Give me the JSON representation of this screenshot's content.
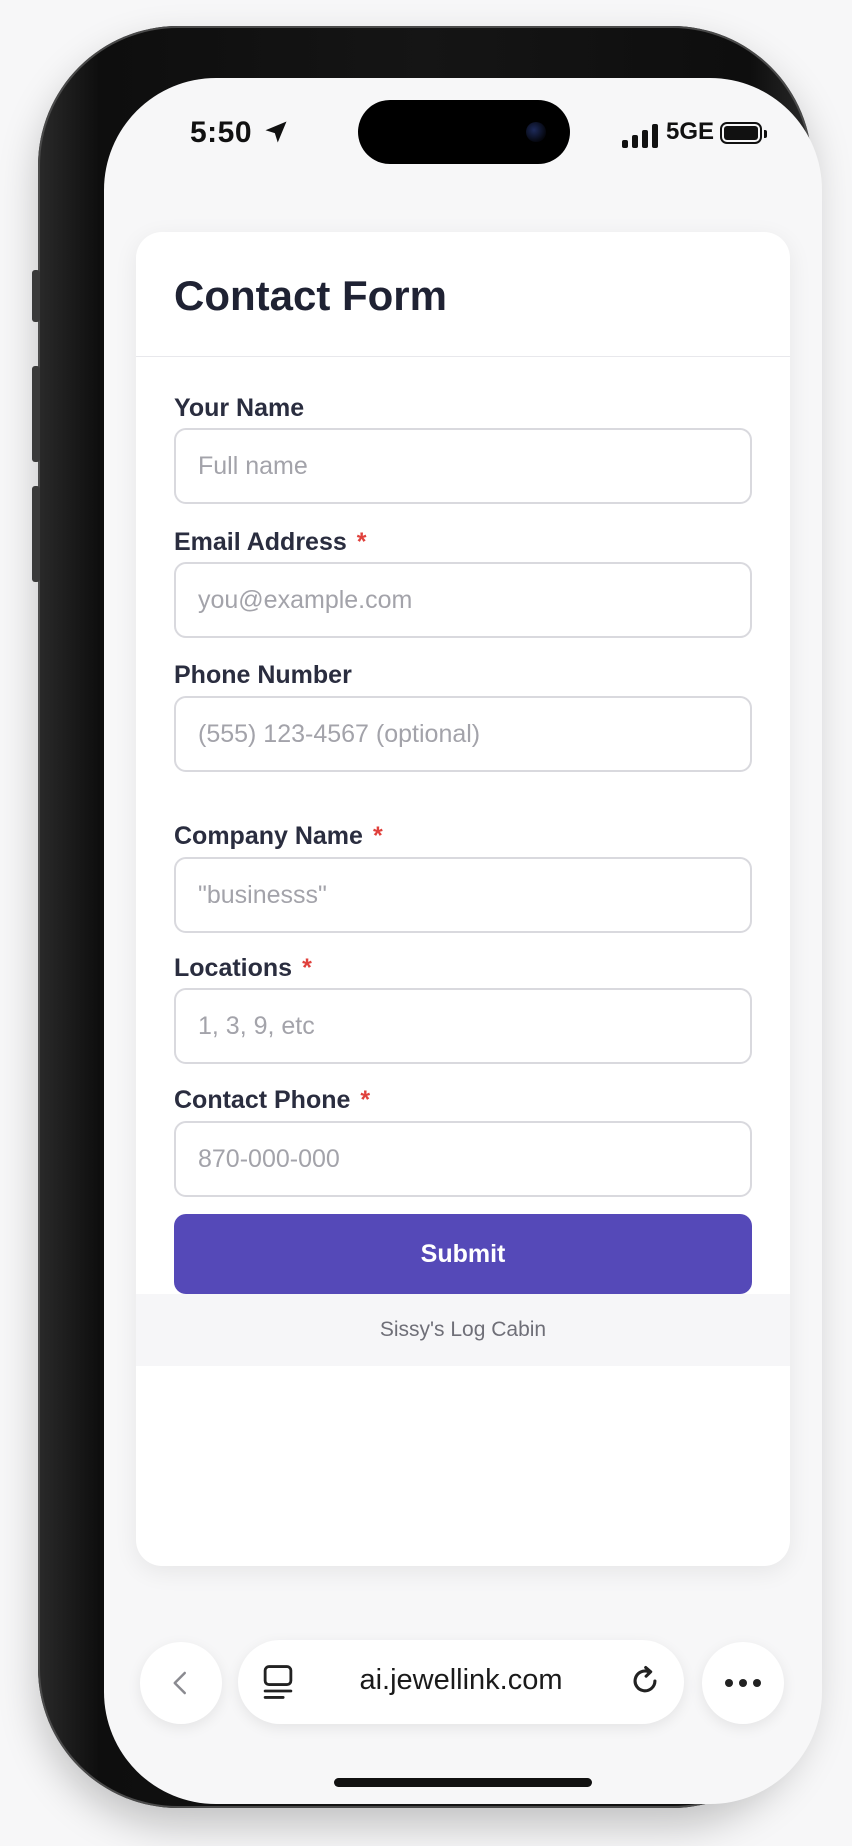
{
  "status_bar": {
    "time": "5:50",
    "network": "5GE"
  },
  "form": {
    "title": "Contact Form",
    "fields": [
      {
        "label": "Your Name",
        "required": false,
        "placeholder": "Full name"
      },
      {
        "label": "Email Address",
        "required": true,
        "placeholder": "you@example.com"
      },
      {
        "label": "Phone Number",
        "required": false,
        "placeholder": "(555) 123-4567 (optional)"
      },
      {
        "label": "Company Name",
        "required": true,
        "placeholder": "\"businesss\""
      },
      {
        "label": "Locations",
        "required": true,
        "placeholder": "1, 3, 9, etc"
      },
      {
        "label": "Contact Phone",
        "required": true,
        "placeholder": "870-000-000"
      }
    ],
    "required_marker": "*",
    "submit_label": "Submit",
    "footer_text": "Sissy's Log Cabin"
  },
  "browser": {
    "url": "ai.jewellink.com",
    "back_icon": "chevron-left-icon",
    "tabs_icon": "tabs-icon",
    "reload_icon": "reload-icon",
    "more_icon": "more-horizontal-icon"
  },
  "colors": {
    "accent": "#5549b8",
    "required": "#e0413c",
    "title": "#1f2233",
    "placeholder": "#a3a3aa"
  }
}
